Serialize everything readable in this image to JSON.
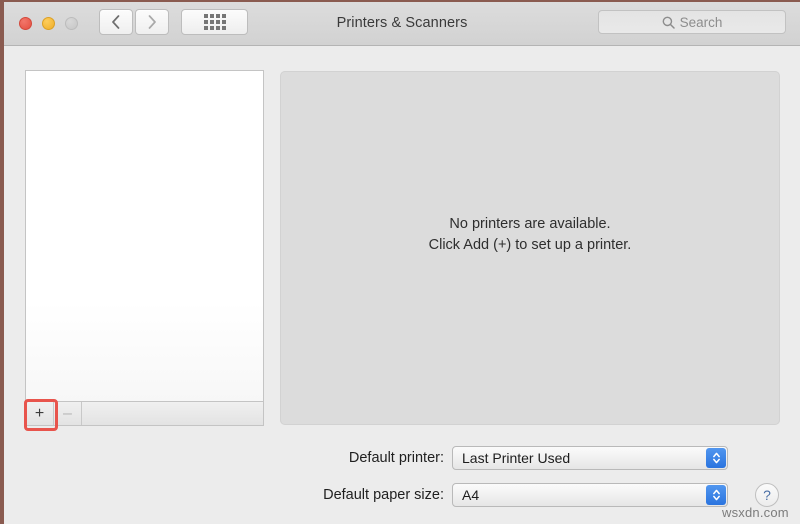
{
  "window": {
    "title": "Printers & Scanners",
    "traffic_lights": [
      {
        "name": "close",
        "color": "#e44f40"
      },
      {
        "name": "minimize",
        "color": "#efae28"
      },
      {
        "name": "zoom",
        "color": "#c6c6c6"
      }
    ]
  },
  "toolbar": {
    "back_icon": "chevron-left-icon",
    "forward_icon": "chevron-right-icon",
    "show_all_icon": "grid-icon"
  },
  "search": {
    "placeholder": "Search",
    "icon": "search-icon",
    "value": ""
  },
  "printer_list": {
    "items": [],
    "add_label": "+",
    "remove_label": "–",
    "add_highlighted": true,
    "highlight_color": "#e8544c"
  },
  "main": {
    "empty_line_1": "No printers are available.",
    "empty_line_2": "Click Add (+) to set up a printer."
  },
  "settings": {
    "default_printer": {
      "label": "Default printer:",
      "value": "Last Printer Used"
    },
    "default_paper_size": {
      "label": "Default paper size:",
      "value": "A4"
    }
  },
  "help": {
    "label": "?"
  },
  "watermark": {
    "text": "wsxdn.com"
  }
}
